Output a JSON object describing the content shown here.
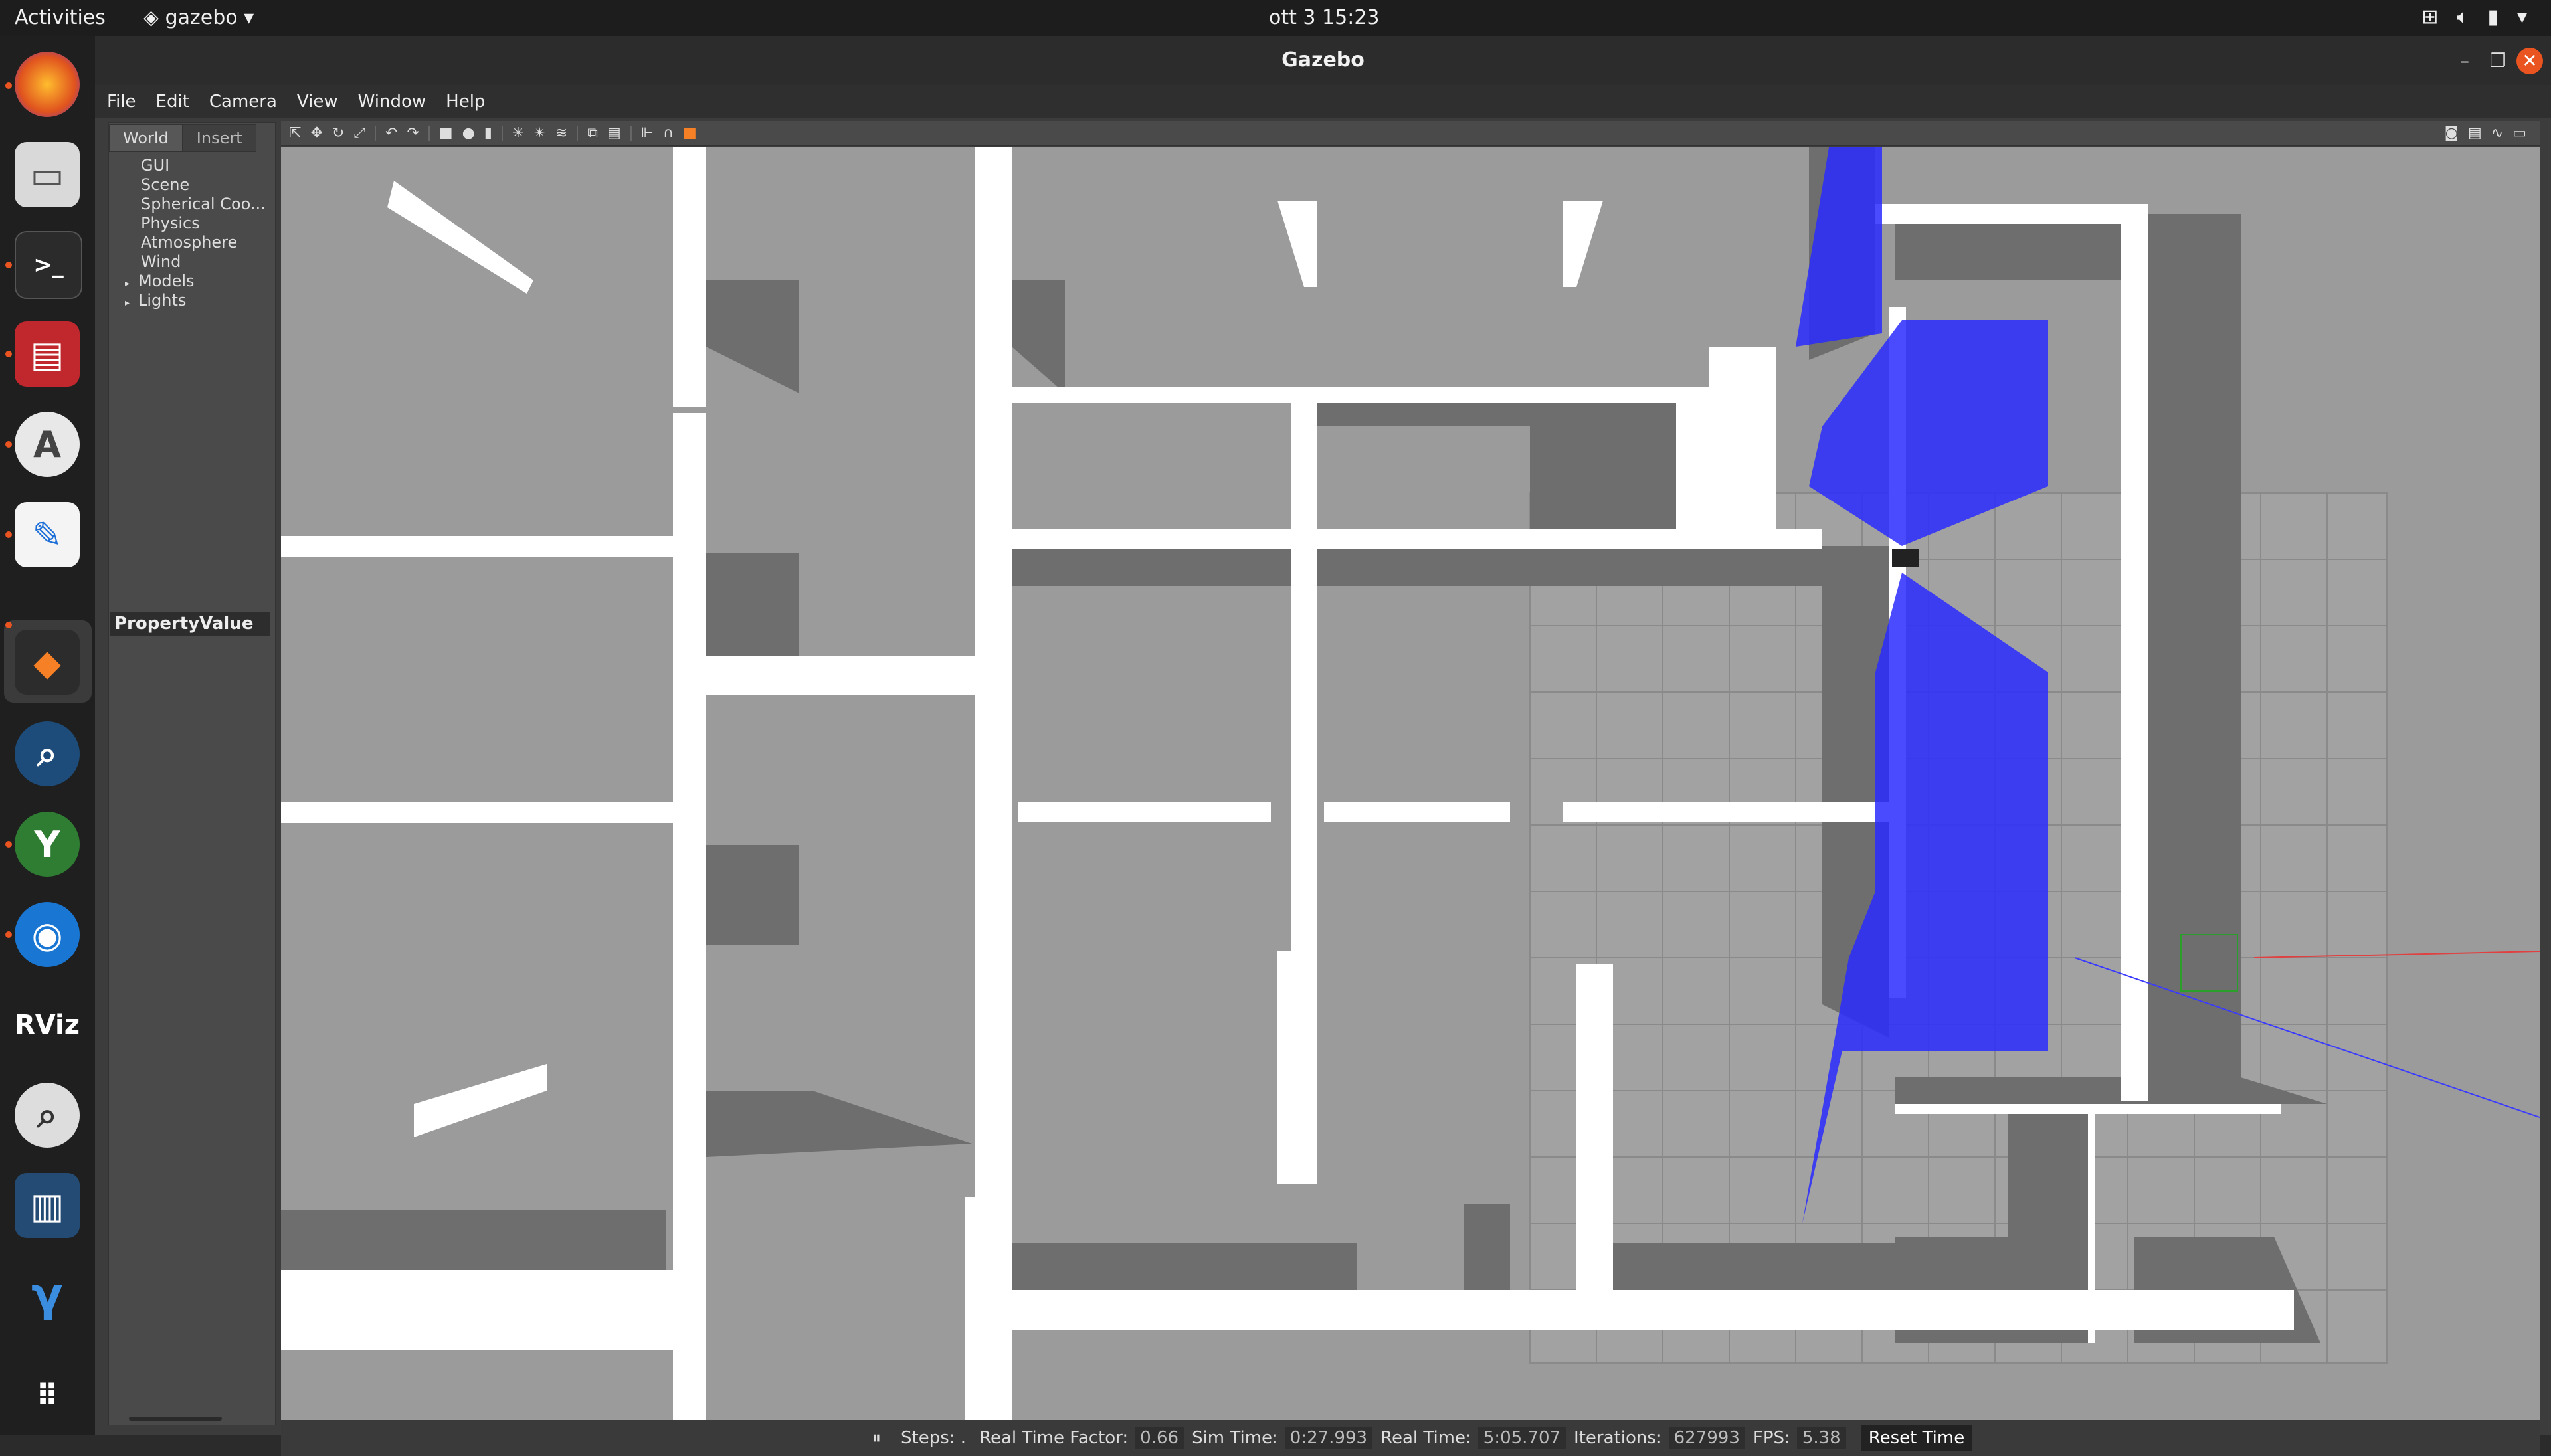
{
  "topbar": {
    "activities": "Activities",
    "app": "gazebo",
    "clock": "ott 3  15:23"
  },
  "dock": {
    "items": [
      "firefox-icon",
      "files-icon",
      "terminal-icon",
      "app-icon",
      "software-center-icon",
      "text-editor-icon",
      "gazebo-icon",
      "search-icon",
      "yakuake-icon",
      "eye-icon",
      "rviz-icon",
      "magnifier-icon",
      "battery-app-icon",
      "gamma-icon",
      "show-apps-icon"
    ],
    "accent": "#e95420"
  },
  "window": {
    "title": "Gazebo",
    "menu": [
      "File",
      "Edit",
      "Camera",
      "View",
      "Window",
      "Help"
    ]
  },
  "leftpanel": {
    "tabs": [
      "World",
      "Insert"
    ],
    "tree": [
      {
        "label": "GUI",
        "expandable": false
      },
      {
        "label": "Scene",
        "expandable": false
      },
      {
        "label": "Spherical Coo...",
        "expandable": false
      },
      {
        "label": "Physics",
        "expandable": false
      },
      {
        "label": "Atmosphere",
        "expandable": false
      },
      {
        "label": "Wind",
        "expandable": false
      },
      {
        "label": "Models",
        "expandable": true
      },
      {
        "label": "Lights",
        "expandable": true
      }
    ],
    "property_header": "PropertyValue"
  },
  "bottombar": {
    "pause": "⏸",
    "steps_label": "Steps: .",
    "rtf_label": "Real Time Factor:",
    "rtf_value": "0.66",
    "sim_label": "Sim Time:",
    "sim_value": "0:27.993",
    "real_label": "Real Time:",
    "real_value": "5:05.707",
    "iter_label": "Iterations:",
    "iter_value": "627993",
    "fps_label": "FPS:",
    "fps_value": "5.38",
    "reset": "Reset Time"
  },
  "scene": {
    "floor_color": "#9a9a9a",
    "wall_top_color": "#ffffff",
    "wall_side_color": "#6e6e6e",
    "laser_color": "#2a2aff"
  }
}
